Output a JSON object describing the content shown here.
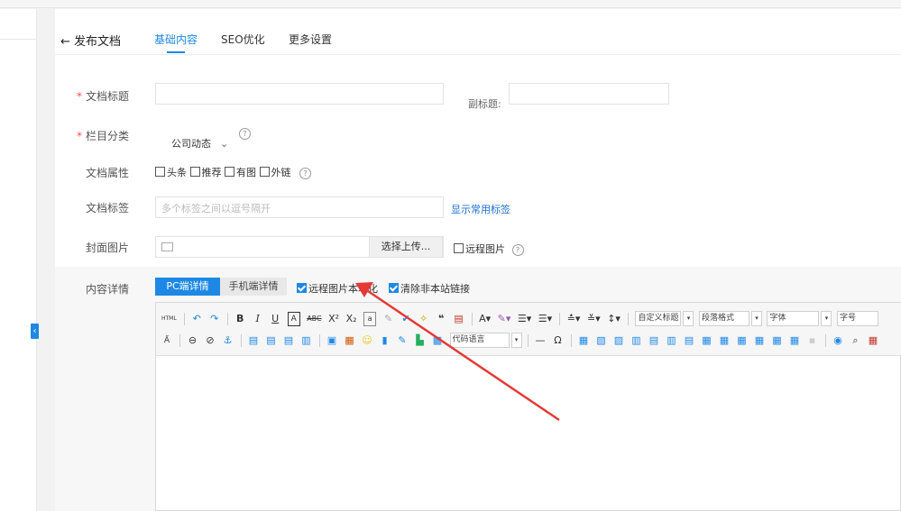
{
  "header": {
    "back_label": "← 发布文档",
    "tabs": [
      "基础内容",
      "SEO优化",
      "更多设置"
    ]
  },
  "form": {
    "title_label": "文档标题",
    "subtitle_label": "副标题:",
    "category_label": "栏目分类",
    "category_value": "公司动态",
    "attr_label": "文档属性",
    "attrs": [
      "头条",
      "推荐",
      "有图",
      "外链"
    ],
    "tags_label": "文档标签",
    "tags_placeholder": "多个标签之间以逗号隔开",
    "show_tags_link": "显示常用标签",
    "cover_label": "封面图片",
    "upload_button": "选择上传...",
    "remote_image": "远程图片",
    "detail_label": "内容详情",
    "pc_tab": "PC端详情",
    "mobile_tab": "手机端详情",
    "localize_remote": "远程图片本地化",
    "clear_links": "清除非本站链接"
  },
  "editor": {
    "html_btn": "HTML",
    "custom_title": "自定义标题",
    "para_format": "段落格式",
    "font": "字体",
    "font_size": "字号",
    "code_lang": "代码语言"
  },
  "colors": {
    "accent": "#1e88e5",
    "required": "#ff4d4f",
    "annotation_arrow": "#e53935"
  }
}
